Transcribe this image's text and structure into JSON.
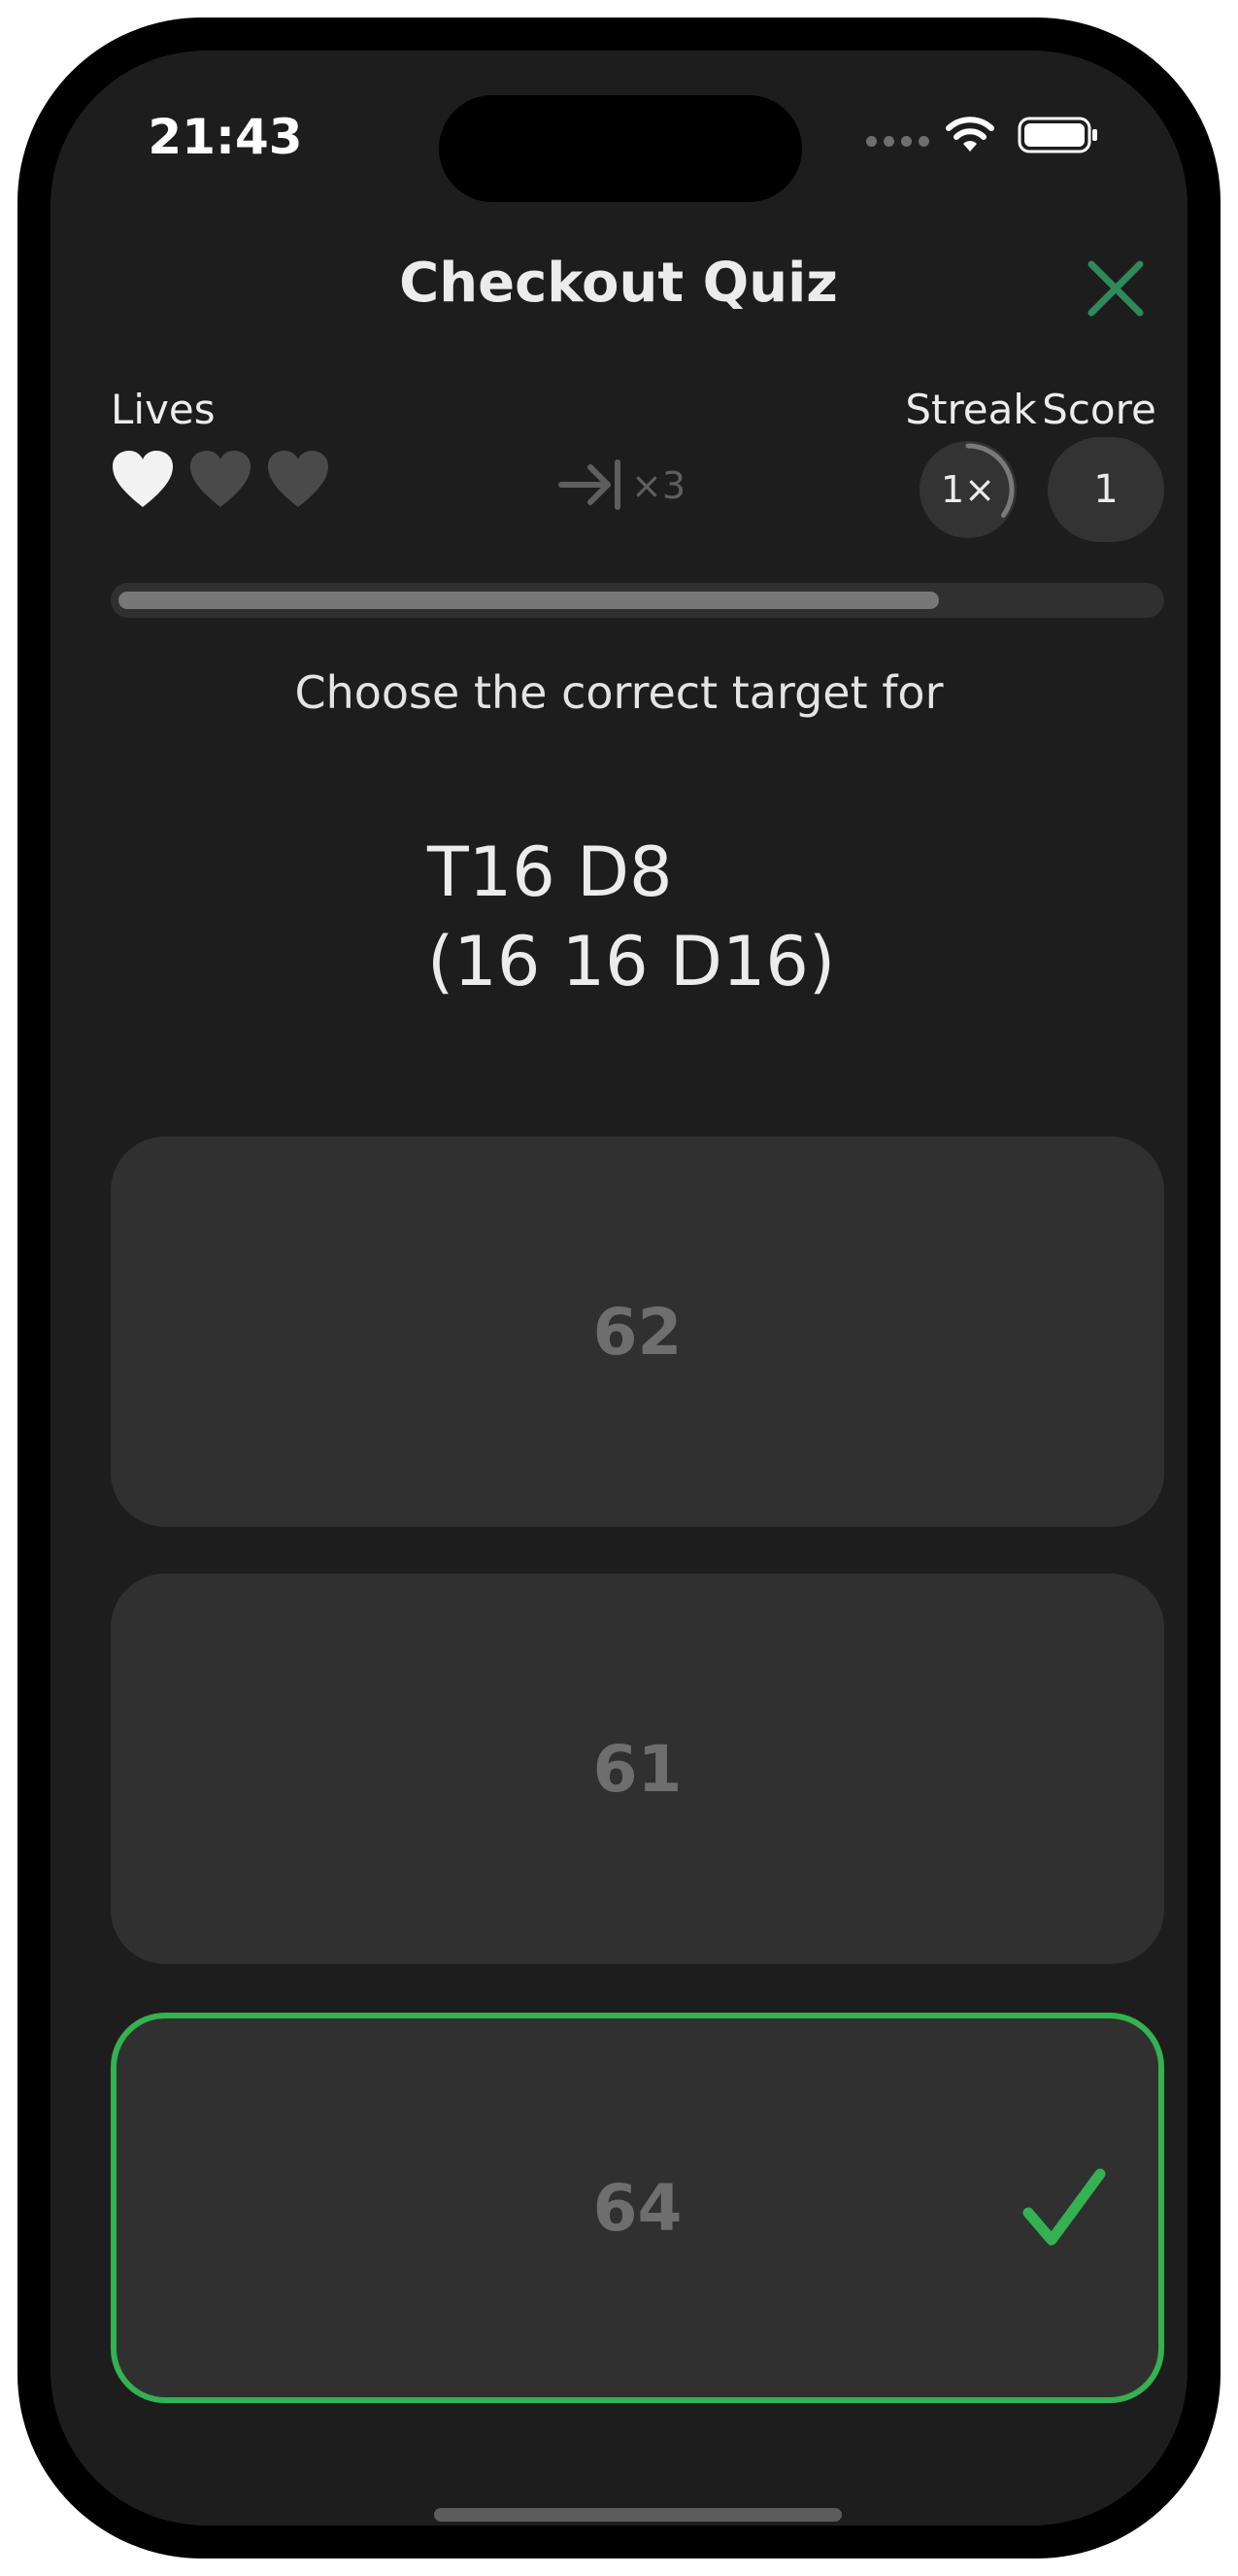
{
  "status_bar": {
    "time": "21:43",
    "wifi_icon": "wifi-icon",
    "battery_icon": "battery-icon"
  },
  "header": {
    "title": "Checkout Quiz",
    "close_icon": "close-icon",
    "accent_color": "#2f8a5b"
  },
  "stats": {
    "lives_label": "Lives",
    "lives_total": 3,
    "lives_remaining": 1,
    "multiplier_icon": "arrow-to-line-icon",
    "multiplier_text": "×3",
    "streak_label": "Streak",
    "streak_value": "1×",
    "streak_progress": 0.35,
    "score_label": "Score",
    "score_value": "1"
  },
  "progress": {
    "fraction": 0.79
  },
  "question": {
    "prompt": "Choose the correct target for",
    "line1": "T16 D8",
    "line2": "(16 16 D16)"
  },
  "answers": [
    {
      "label": "62",
      "state": "neutral"
    },
    {
      "label": "61",
      "state": "neutral"
    },
    {
      "label": "64",
      "state": "correct"
    }
  ],
  "colors": {
    "background": "#1d1d1d",
    "card": "#303030",
    "correct": "#34b150",
    "muted_text": "#6e6e6e"
  }
}
